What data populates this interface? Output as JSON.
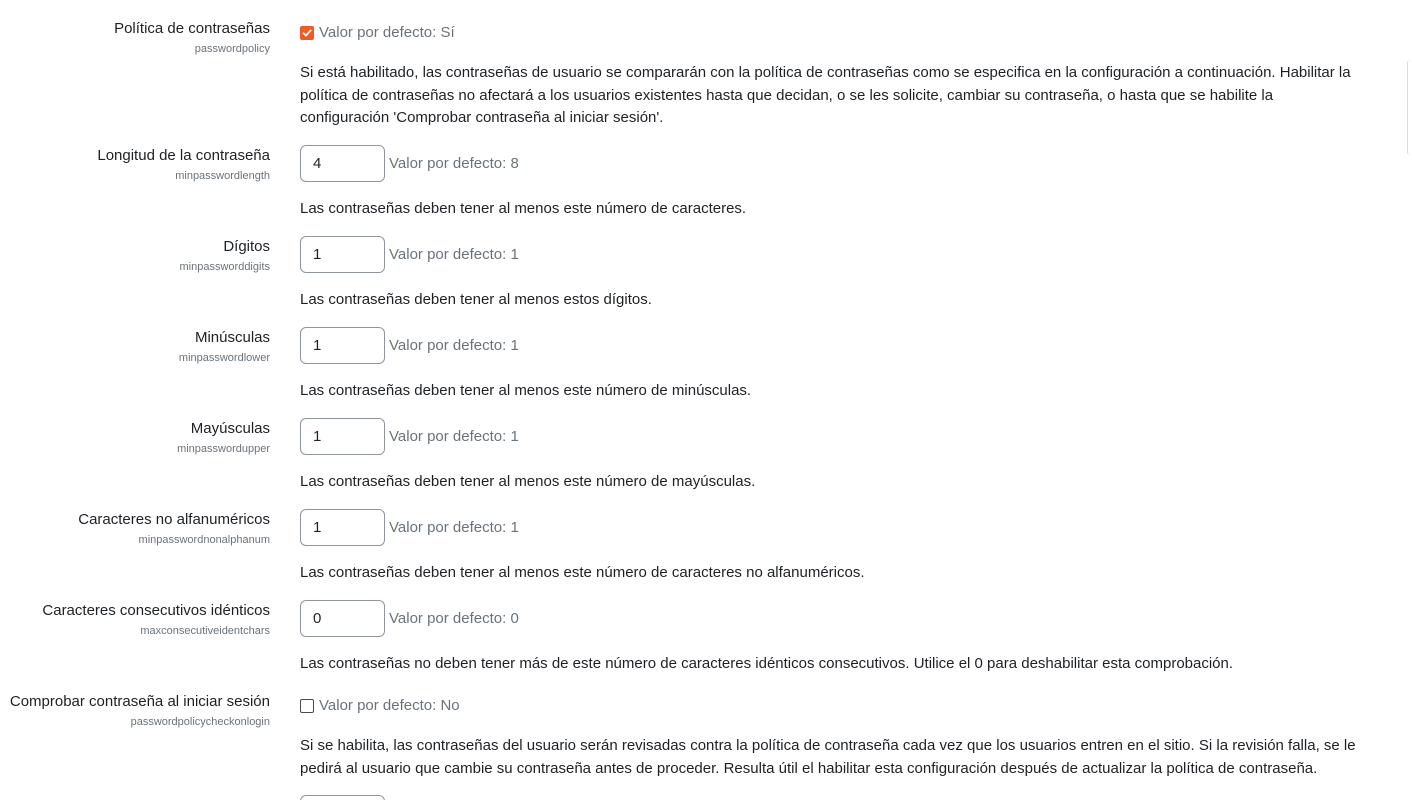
{
  "settings": [
    {
      "title": "Política de contraseñas",
      "key": "passwordpolicy",
      "type": "checkbox",
      "checked": true,
      "default": "Valor por defecto: Sí",
      "description": "Si está habilitado, las contraseñas de usuario se compararán con la política de contraseñas como se especifica en la configuración a continuación. Habilitar la política de contraseñas no afectará a los usuarios existentes hasta que decidan, o se les solicite, cambiar su contraseña, o hasta que se habilite la configuración 'Comprobar contraseña al iniciar sesión'."
    },
    {
      "title": "Longitud de la contraseña",
      "key": "minpasswordlength",
      "type": "text",
      "value": "4",
      "default": "Valor por defecto: 8",
      "description": "Las contraseñas deben tener al menos este número de caracteres."
    },
    {
      "title": "Dígitos",
      "key": "minpassworddigits",
      "type": "text",
      "value": "1",
      "default": "Valor por defecto: 1",
      "description": "Las contraseñas deben tener al menos estos dígitos."
    },
    {
      "title": "Minúsculas",
      "key": "minpasswordlower",
      "type": "text",
      "value": "1",
      "default": "Valor por defecto: 1",
      "description": "Las contraseñas deben tener al menos este número de minúsculas."
    },
    {
      "title": "Mayúsculas",
      "key": "minpasswordupper",
      "type": "text",
      "value": "1",
      "default": "Valor por defecto: 1",
      "description": "Las contraseñas deben tener al menos este número de mayúsculas."
    },
    {
      "title": "Caracteres no alfanuméricos",
      "key": "minpasswordnonalphanum",
      "type": "text",
      "value": "1",
      "default": "Valor por defecto: 1",
      "description": "Las contraseñas deben tener al menos este número de caracteres no alfanuméricos."
    },
    {
      "title": "Caracteres consecutivos idénticos",
      "key": "maxconsecutiveidentchars",
      "type": "text",
      "value": "0",
      "default": "Valor por defecto: 0",
      "description": "Las contraseñas no deben tener más de este número de caracteres idénticos consecutivos. Utilice el 0 para deshabilitar esta comprobación."
    },
    {
      "title": "Comprobar contraseña al iniciar sesión",
      "key": "passwordpolicycheckonlogin",
      "type": "checkbox",
      "checked": false,
      "default": "Valor por defecto: No",
      "description": "Si se habilita, las contraseñas del usuario serán revisadas contra la política de contraseña cada vez que los usuarios entren en el sitio. Si la revisión falla, se le pedirá al usuario que cambie su contraseña antes de proceder. Resulta útil el habilitar esta configuración después de actualizar la política de contraseña."
    }
  ],
  "colors": {
    "accent": "#f15a22",
    "text": "#1d2125",
    "muted": "#6a737b",
    "border": "#8f959e"
  },
  "icons": {
    "checkbox_checked": "checkmark-icon"
  }
}
